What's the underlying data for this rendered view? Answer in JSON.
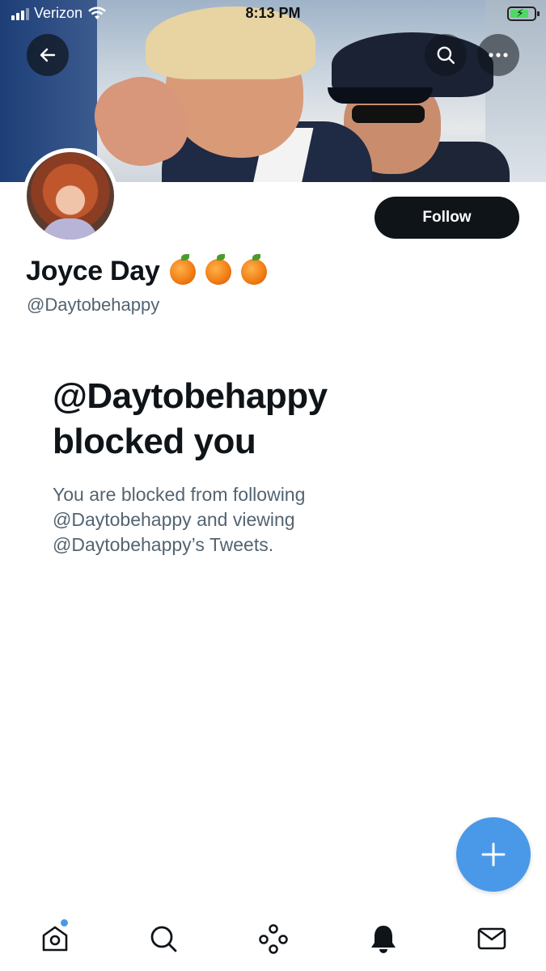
{
  "status_bar": {
    "carrier": "Verizon",
    "time": "8:13 PM"
  },
  "profile": {
    "display_name": "Joyce Day",
    "name_emoji_icons": [
      "tangerine-icon",
      "tangerine-icon",
      "tangerine-icon"
    ],
    "handle": "@Daytobehappy",
    "follow_label": "Follow"
  },
  "blocked": {
    "title_line1": "@Daytobehappy",
    "title_line2": "blocked you",
    "description_line1": "You are blocked from following",
    "description_line2": "@Daytobehappy and viewing",
    "description_line3": "@Daytobehappy’s Tweets."
  },
  "tabs": [
    {
      "name": "home",
      "icon": "home-icon",
      "has_notification_dot": true
    },
    {
      "name": "search",
      "icon": "search-icon"
    },
    {
      "name": "spaces",
      "icon": "spaces-icon"
    },
    {
      "name": "notifications",
      "icon": "bell-icon"
    },
    {
      "name": "messages",
      "icon": "mail-icon"
    }
  ],
  "colors": {
    "accent": "#4a99e9",
    "text_primary": "#0f1419",
    "text_secondary": "#536471"
  }
}
